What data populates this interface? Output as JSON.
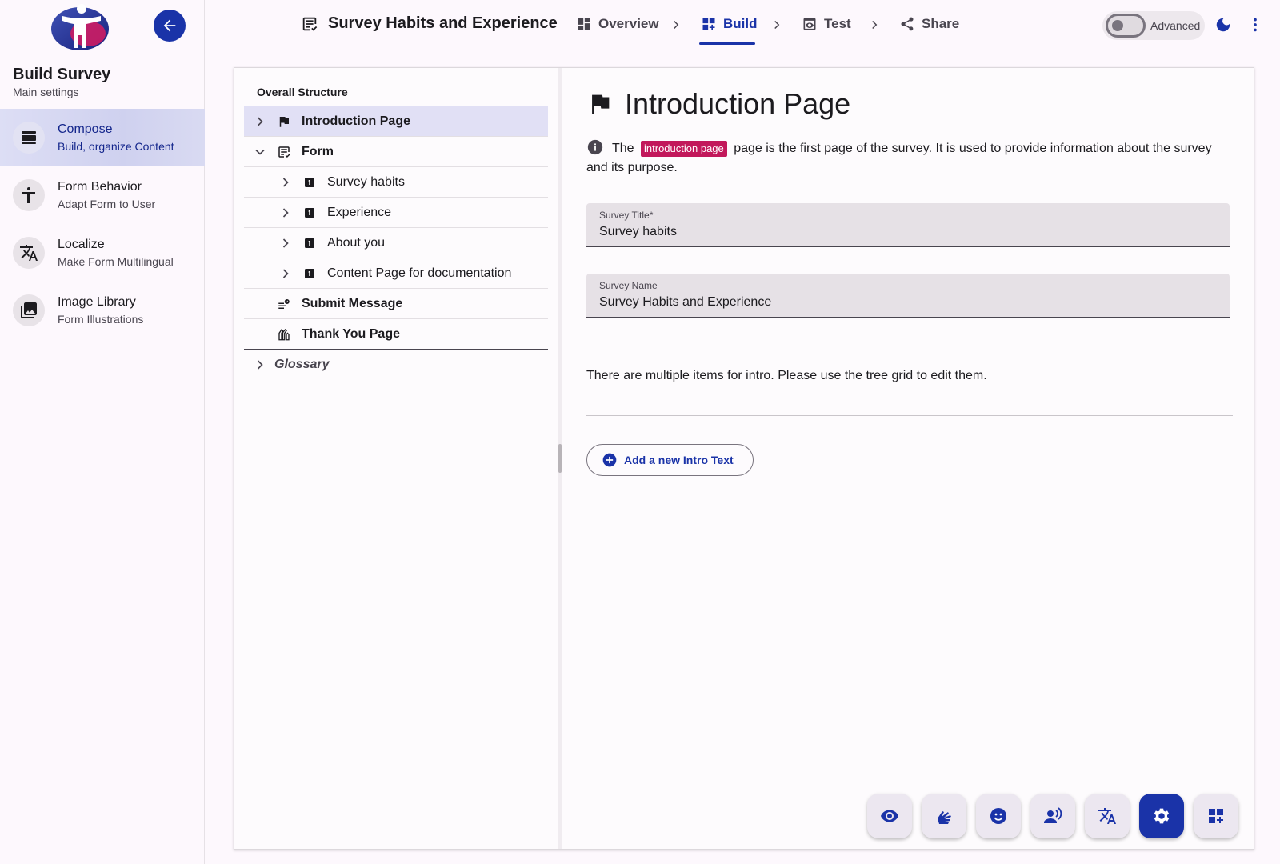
{
  "sidebar": {
    "title": "Build Survey",
    "subtitle": "Main settings",
    "items": [
      {
        "label": "Compose",
        "sub": "Build, organize Content"
      },
      {
        "label": "Form Behavior",
        "sub": "Adapt Form to User"
      },
      {
        "label": "Localize",
        "sub": "Make Form Multilingual"
      },
      {
        "label": "Image Library",
        "sub": "Form Illustrations"
      }
    ]
  },
  "header": {
    "survey_title": "Survey Habits and Experience",
    "steps": [
      {
        "label": "Overview"
      },
      {
        "label": "Build"
      },
      {
        "label": "Test"
      },
      {
        "label": "Share"
      }
    ],
    "advanced_label": "Advanced"
  },
  "tree": {
    "heading": "Overall Structure",
    "rows": [
      {
        "label": "Introduction Page"
      },
      {
        "label": "Form"
      },
      {
        "label": "Survey habits"
      },
      {
        "label": "Experience"
      },
      {
        "label": "About you"
      },
      {
        "label": "Content Page for documentation"
      },
      {
        "label": "Submit Message"
      },
      {
        "label": "Thank You Page"
      },
      {
        "label": "Glossary"
      }
    ]
  },
  "detail": {
    "heading": "Introduction Page",
    "info_prefix": "The",
    "info_chip": "introduction page",
    "info_suffix": "page is the first page of the survey. It is used to provide information about the survey and its purpose.",
    "fields": [
      {
        "label": "Survey Title*",
        "value": "Survey habits"
      },
      {
        "label": "Survey Name",
        "value": "Survey Habits and Experience"
      }
    ],
    "multi_note": "There are multiple items for intro. Please use the tree grid to edit them.",
    "add_button": "Add a new Intro Text"
  },
  "colors": {
    "primary": "#1a33a8",
    "chip": "#c2185b",
    "selected_row": "#e1e0f5"
  }
}
